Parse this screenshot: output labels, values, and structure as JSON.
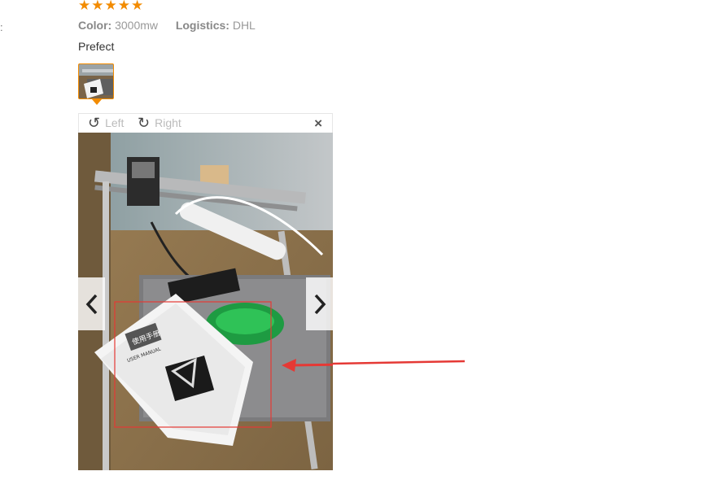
{
  "page": {
    "edge_mark": ":"
  },
  "review": {
    "rating": 5,
    "stars": [
      "★",
      "★",
      "★",
      "★",
      "★"
    ],
    "color_label": "Color:",
    "color_value": "3000mw",
    "logistics_label": "Logistics:",
    "logistics_value": "DHL",
    "text": "Prefect"
  },
  "viewer": {
    "rotate_left_label": "Left",
    "rotate_right_label": "Right",
    "close_label": "×",
    "manual": {
      "title": "使用手册",
      "subtitle": "USER MANUAL"
    }
  },
  "colors": {
    "accent": "#f28b00",
    "annotation": "#e53935"
  }
}
